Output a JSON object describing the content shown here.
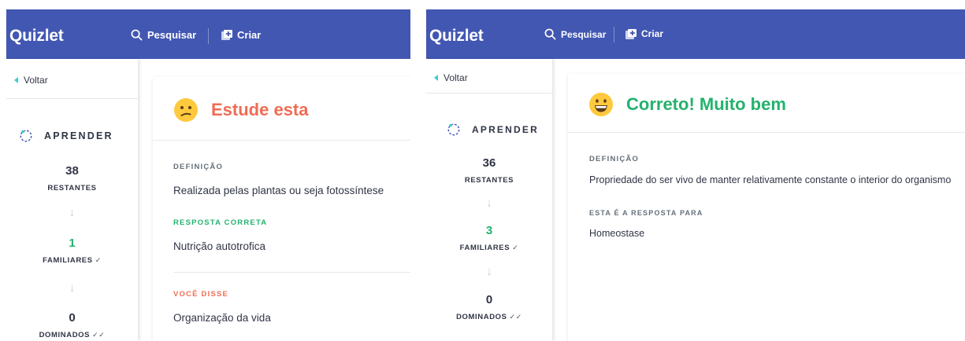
{
  "left": {
    "topbar": {
      "logo": "Quizlet",
      "search_label": "Pesquisar",
      "create_label": "Criar"
    },
    "sidebar": {
      "back_label": "Voltar",
      "mode_label": "APRENDER",
      "remaining_count": "38",
      "remaining_label": "RESTANTES",
      "familiar_count": "1",
      "familiar_label": "FAMILIARES",
      "mastered_count": "0",
      "mastered_label": "DOMINADOS"
    },
    "main": {
      "feedback_title": "Estude esta",
      "definition_label": "DEFINIÇÃO",
      "definition_text": "Realizada pelas plantas ou seja fotossíntese",
      "correct_label": "RESPOSTA CORRETA",
      "correct_text": "Nutrição autotrofica",
      "you_said_label": "VOCÊ DISSE",
      "you_said_text": "Organização da vida"
    }
  },
  "right": {
    "topbar": {
      "logo": "Quizlet",
      "search_label": "Pesquisar",
      "create_label": "Criar"
    },
    "sidebar": {
      "back_label": "Voltar",
      "mode_label": "APRENDER",
      "remaining_count": "36",
      "remaining_label": "RESTANTES",
      "familiar_count": "3",
      "familiar_label": "FAMILIARES",
      "mastered_count": "0",
      "mastered_label": "DOMINADOS"
    },
    "main": {
      "feedback_title": "Correto! Muito bem",
      "definition_label": "DEFINIÇÃO",
      "definition_text": "Propriedade do ser vivo de manter relativamente constante o interior do organismo",
      "answer_label": "ESTA É A RESPOSTA PARA",
      "answer_text": "Homeostase"
    }
  },
  "colors": {
    "brand": "#4257b2",
    "correct": "#23b26d",
    "incorrect": "#ef6c55",
    "text": "#303545"
  },
  "icons": {
    "search": "search-icon",
    "create": "create-icon",
    "back": "back-arrow-icon",
    "learn": "learn-mode-icon",
    "down": "down-arrow-icon",
    "check": "check-icon",
    "double_check": "double-check-icon",
    "confused": "confused-emoji-icon",
    "grin": "grinning-emoji-icon"
  }
}
